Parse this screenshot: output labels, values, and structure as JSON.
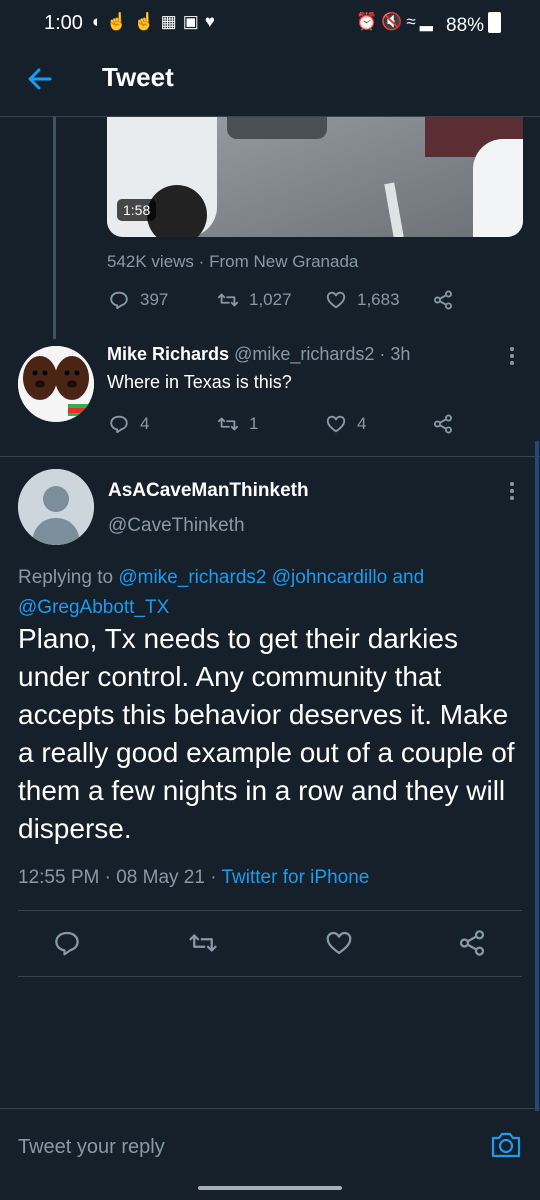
{
  "status_bar": {
    "time": "1:00",
    "left_icons": [
      "notification-icon",
      "hand-icon",
      "hand-icon",
      "app-icon",
      "image-icon",
      "heart-icon"
    ],
    "right_icons": [
      "alarm-icon",
      "mute-icon",
      "wifi-icon",
      "signal-icon"
    ],
    "battery": "88%"
  },
  "header": {
    "title": "Tweet",
    "back_icon": "back-arrow-icon"
  },
  "video_tweet": {
    "duration": "1:58",
    "views": "542K views",
    "separator": "·",
    "location": "From New Granada",
    "replies": "397",
    "retweets": "1,027",
    "likes": "1,683"
  },
  "reply": {
    "author_name": "Mike Richards",
    "handle": "@mike_richards2",
    "time": "3h",
    "separator": "·",
    "text": "Where in Texas is this?",
    "replies": "4",
    "retweets": "1",
    "likes": "4"
  },
  "main_tweet": {
    "author_name": "AsACaveManThinketh",
    "handle": "@CaveThinketh",
    "replying_label": "Replying to",
    "mention_1": "@mike_richards2",
    "mention_2": "@johncardillo",
    "and_label": "and",
    "mention_3": "@GregAbbott_TX",
    "text": "Plano, Tx needs to get their darkies under control. Any community that accepts this behavior deserves it. Make a really good example out of a couple of them a few nights in a row and they will disperse.",
    "time": "12:55 PM",
    "date": "08 May 21",
    "separator": "·",
    "client": "Twitter for iPhone"
  },
  "composer": {
    "placeholder": "Tweet your reply"
  },
  "colors": {
    "background": "#15202b",
    "accent": "#1d9bf0",
    "muted": "#8899a6",
    "divider": "#38444d"
  }
}
